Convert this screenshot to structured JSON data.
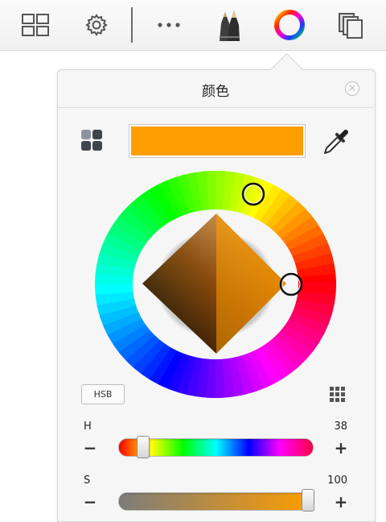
{
  "toolbar": {
    "icons": [
      "layout-grid-icon",
      "gear-icon",
      "more-icon",
      "brush-tools-icon",
      "color-wheel-icon",
      "layers-icon"
    ]
  },
  "panel": {
    "title": "颜色",
    "close_symbol": "×",
    "current_color": "#ff9e00",
    "mode_button_label": "HSB",
    "hue_handle_angle_deg": 38,
    "sliders": {
      "h": {
        "label": "H",
        "value": "38",
        "minus": "−",
        "plus": "+"
      },
      "s": {
        "label": "S",
        "value": "100",
        "minus": "−",
        "plus": "+"
      }
    }
  }
}
